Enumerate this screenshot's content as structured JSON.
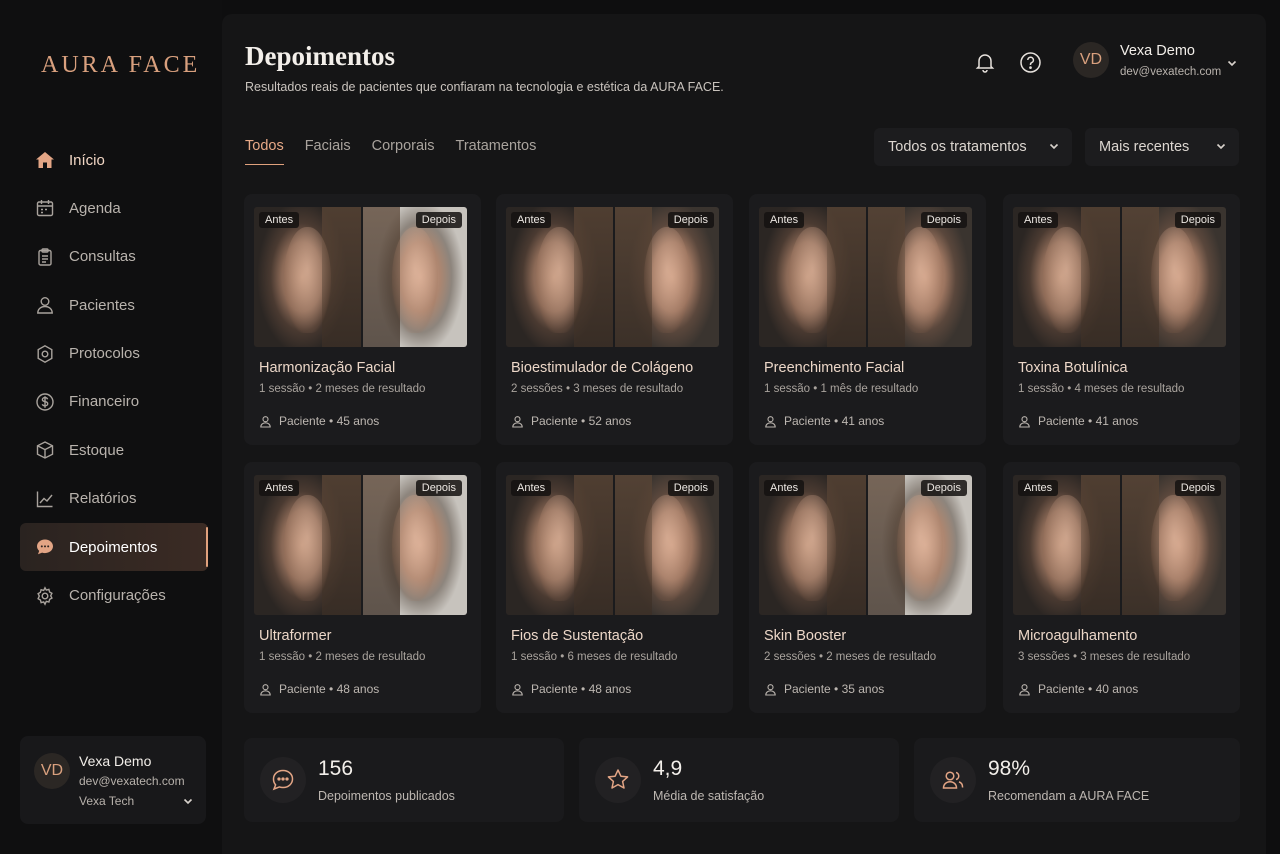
{
  "brand": {
    "logo": "AURA FACE",
    "accent": "#e0a17d"
  },
  "sidebar": {
    "items": [
      {
        "label": "Início",
        "icon": "home-icon"
      },
      {
        "label": "Agenda",
        "icon": "calendar-icon"
      },
      {
        "label": "Consultas",
        "icon": "clipboard-icon"
      },
      {
        "label": "Pacientes",
        "icon": "user-icon"
      },
      {
        "label": "Protocolos",
        "icon": "gear-icon"
      },
      {
        "label": "Financeiro",
        "icon": "dollar-icon"
      },
      {
        "label": "Estoque",
        "icon": "box-icon"
      },
      {
        "label": "Relatórios",
        "icon": "chart-icon"
      },
      {
        "label": "Depoimentos",
        "icon": "chat-icon",
        "active": true
      },
      {
        "label": "Configurações",
        "icon": "settings-icon"
      }
    ],
    "user": {
      "initials": "VD",
      "name": "Vexa Demo",
      "email": "dev@vexatech.com",
      "org": "Vexa Tech"
    }
  },
  "header": {
    "title": "Depoimentos",
    "subtitle": "Resultados reais de pacientes que confiaram na tecnologia e estética da AURA FACE.",
    "user": {
      "initials": "VD",
      "name": "Vexa Demo",
      "email": "dev@vexatech.com"
    }
  },
  "tabs": [
    "Todos",
    "Faciais",
    "Corporais",
    "Tratamentos"
  ],
  "filters": {
    "treatment": "Todos os tratamentos",
    "sort": "Mais recentes"
  },
  "labels": {
    "before": "Antes",
    "after": "Depois"
  },
  "cards": [
    {
      "title": "Harmonização Facial",
      "meta": "1 sessão • 2 meses de resultado",
      "patient": "Paciente • 45 anos"
    },
    {
      "title": "Bioestimulador de Colágeno",
      "meta": "2 sessões • 3 meses de resultado",
      "patient": "Paciente • 52 anos"
    },
    {
      "title": "Preenchimento Facial",
      "meta": "1 sessão • 1 mês de resultado",
      "patient": "Paciente • 41 anos"
    },
    {
      "title": "Toxina Botulínica",
      "meta": "1 sessão • 4 meses de resultado",
      "patient": "Paciente • 41 anos"
    },
    {
      "title": "Ultraformer",
      "meta": "1 sessão • 2 meses de resultado",
      "patient": "Paciente • 48 anos"
    },
    {
      "title": "Fios de Sustentação",
      "meta": "1 sessão • 6 meses de resultado",
      "patient": "Paciente • 48 anos"
    },
    {
      "title": "Skin Booster",
      "meta": "2 sessões • 2 meses de resultado",
      "patient": "Paciente • 35 anos"
    },
    {
      "title": "Microagulhamento",
      "meta": "3 sessões • 3 meses de resultado",
      "patient": "Paciente • 40 anos"
    }
  ],
  "stats": [
    {
      "value": "156",
      "label": "Depoimentos publicados",
      "icon": "chat-bubble-icon"
    },
    {
      "value": "4,9",
      "label": "Média de satisfação",
      "icon": "star-icon"
    },
    {
      "value": "98%",
      "label": "Recomendam a AURA FACE",
      "icon": "users-icon"
    }
  ]
}
